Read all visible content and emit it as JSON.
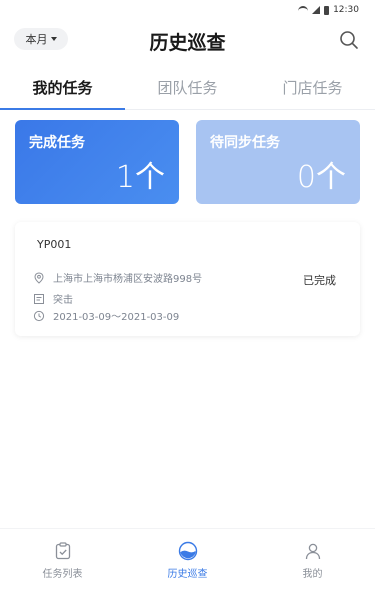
{
  "status_bar": {
    "time": "12:30"
  },
  "header": {
    "month_label": "本月",
    "title": "历史巡查"
  },
  "tabs": [
    {
      "label": "我的任务",
      "active": true
    },
    {
      "label": "团队任务",
      "active": false
    },
    {
      "label": "门店任务",
      "active": false
    }
  ],
  "stats": {
    "done": {
      "label": "完成任务",
      "value": "1个"
    },
    "pending": {
      "label": "待同步任务",
      "value": "0个"
    }
  },
  "task": {
    "code": "YP001",
    "address": "上海市上海市杨浦区安波路998号",
    "type": "突击",
    "date_range": "2021-03-09～2021-03-09",
    "status": "已完成"
  },
  "bottom_nav": [
    {
      "label": "任务列表",
      "icon": "clipboard-check-icon",
      "active": false
    },
    {
      "label": "历史巡查",
      "icon": "history-circle-icon",
      "active": true
    },
    {
      "label": "我的",
      "icon": "user-icon",
      "active": false
    }
  ],
  "colors": {
    "accent": "#3b7be6",
    "card_done": "#3a78e8",
    "card_pending": "#a8c4f2"
  }
}
